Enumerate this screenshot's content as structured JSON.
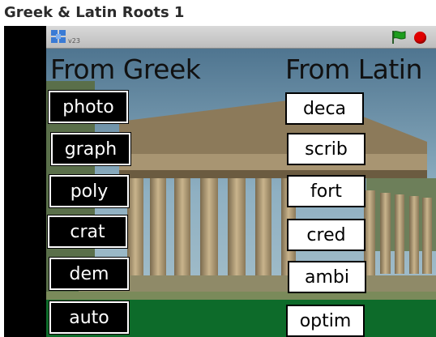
{
  "page": {
    "title": "Greek & Latin Roots 1"
  },
  "player": {
    "version": "v23",
    "icons": {
      "logo": "scratch-logo-icon",
      "flag": "green-flag-icon",
      "stop": "stop-icon"
    },
    "colors": {
      "flag": "#1e9e1e",
      "stop": "#e00000"
    }
  },
  "stage": {
    "heading_greek": "From Greek",
    "heading_latin": "From Latin",
    "greek_roots": [
      "photo",
      "graph",
      "poly",
      "crat",
      "dem",
      "auto"
    ],
    "latin_roots": [
      "deca",
      "scrib",
      "fort",
      "cred",
      "ambi",
      "optim"
    ],
    "colors": {
      "ground": "#0d6b2a",
      "greek_tile": "#000000",
      "latin_tile": "#ffffff"
    }
  }
}
